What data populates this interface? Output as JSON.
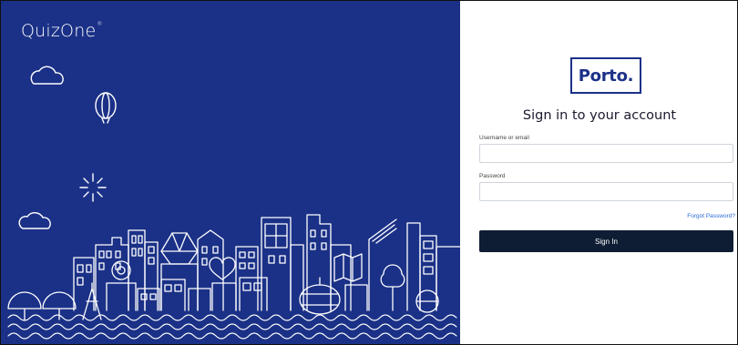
{
  "hero": {
    "brand_name": "QuizOne",
    "brand_mark": "®",
    "background_color": "#1b3187",
    "illustration": "city-skyline-line-illustration"
  },
  "login": {
    "logo_text": "Porto.",
    "title": "Sign in to your account",
    "username_label": "Username or email",
    "password_label": "Password",
    "forgot_password": "Forgot Password?",
    "sign_in_button": "Sign In",
    "accent_color": "#1b3187",
    "button_color": "#0e1d33",
    "link_color": "#2a6bd6"
  }
}
